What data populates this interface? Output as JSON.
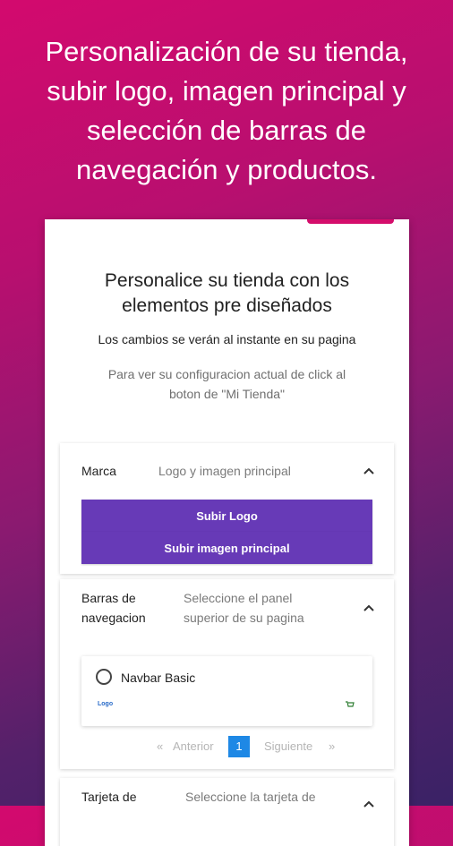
{
  "headline": {
    "line1": "Personalización de su tienda,",
    "line2": "subir logo, imagen principal y",
    "line3": "selección de barras de",
    "line4": "navegación y productos."
  },
  "card": {
    "title_line1": "Personalice su tienda con los",
    "title_line2": "elementos pre diseñados",
    "subtitle": "Los cambios se verán al instante en su pagina",
    "hint_line1": "Para ver su configuracion actual de click al",
    "hint_line2": "boton de \"Mi Tienda\""
  },
  "marca": {
    "label": "Marca",
    "description": "Logo y imagen principal",
    "upload_logo_label": "Subir Logo",
    "upload_image_label": "Subir imagen principal"
  },
  "navbars": {
    "label_line1": "Barras de",
    "label_line2": "navegacion",
    "desc_line1": "Seleccione el panel",
    "desc_line2": "superior de su pagina",
    "option_label": "Navbar Basic",
    "option_logo_text": "Logo"
  },
  "pagination": {
    "prev_arrow": "«",
    "prev_label": "Anterior",
    "current_page": "1",
    "next_label": "Siguiente",
    "next_arrow": "»"
  },
  "tarjeta": {
    "label": "Tarjeta de",
    "desc": "Seleccione la tarjeta de"
  },
  "colors": {
    "accent_button": "#673ab7",
    "active_page": "#1e88e5",
    "top_accent": "#d40d6b"
  },
  "icons": {
    "collapse": "chevron-up-icon",
    "logo": "mini-logo-icon",
    "cart": "cart-icon"
  }
}
